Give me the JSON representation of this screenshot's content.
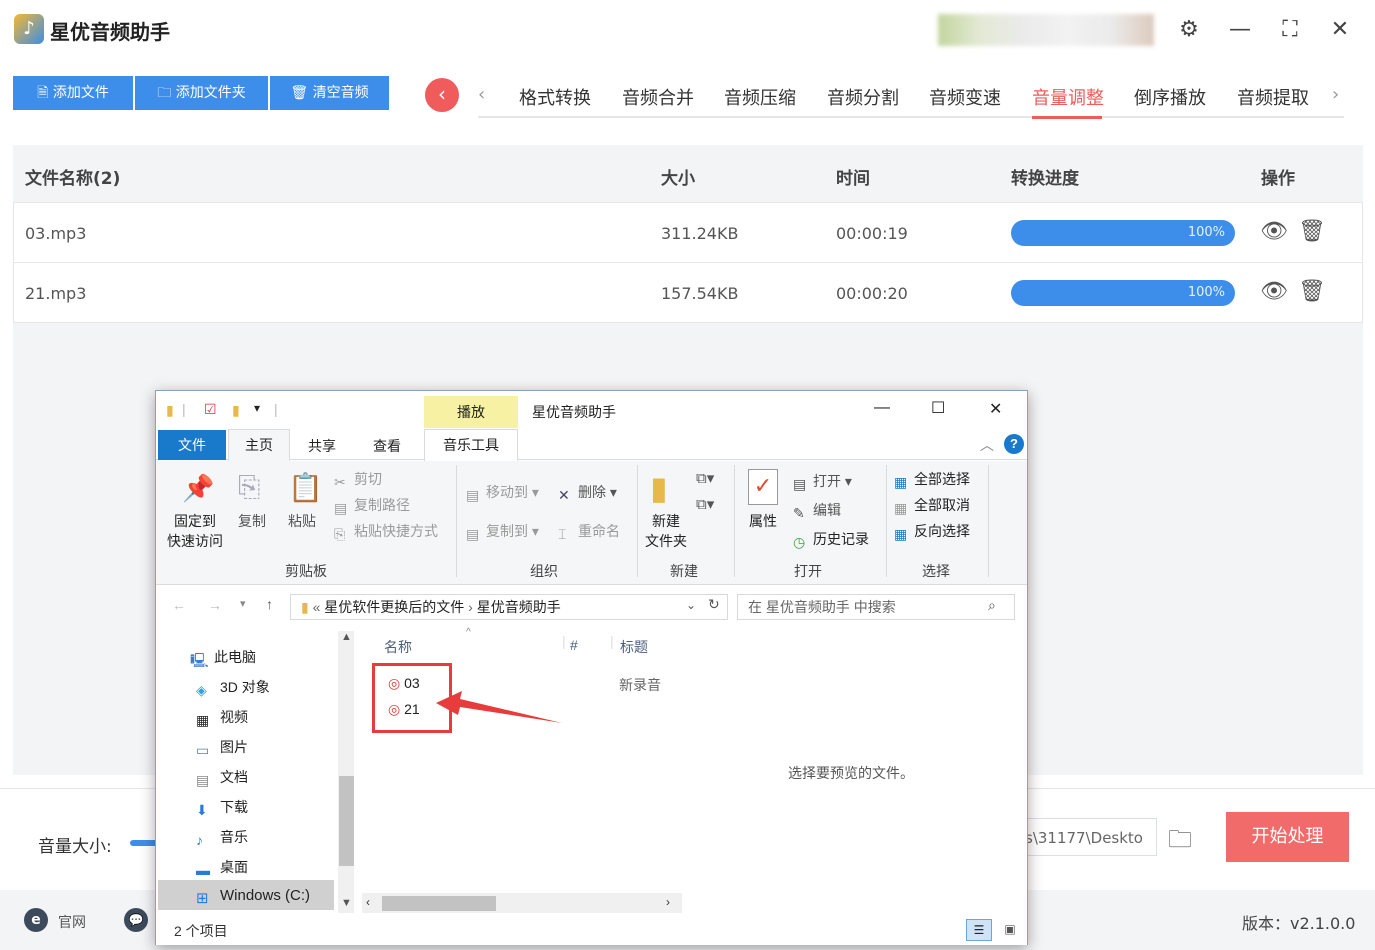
{
  "app": {
    "title": "星优音频助手",
    "window_controls": {
      "settings": "⚙",
      "minimize": "—",
      "maximize": "⛶",
      "close": "✕"
    }
  },
  "toolbar": {
    "add_file": "添加文件",
    "add_folder": "添加文件夹",
    "clear": "清空音频"
  },
  "tabs": {
    "prev": "‹",
    "next": "›",
    "items": [
      "格式转换",
      "音频合并",
      "音频压缩",
      "音频分割",
      "音频变速",
      "音量调整",
      "倒序播放",
      "音频提取"
    ],
    "active": "音量调整"
  },
  "table": {
    "headers": {
      "name": "文件名称(2)",
      "size": "大小",
      "time": "时间",
      "progress": "转换进度",
      "actions": "操作"
    },
    "rows": [
      {
        "name": "03.mp3",
        "size": "311.24KB",
        "time": "00:00:19",
        "progress": "100%",
        "progress_value": 100
      },
      {
        "name": "21.mp3",
        "size": "157.54KB",
        "time": "00:00:20",
        "progress": "100%",
        "progress_value": 100
      }
    ]
  },
  "bottom": {
    "volume_label": "音量大小:",
    "output_path": "s\\31177\\Deskto",
    "start_button": "开始处理"
  },
  "footer": {
    "site_label": "官网",
    "version": "版本：v2.1.0.0"
  },
  "explorer": {
    "context_tab": "播放",
    "title": "星优音频助手",
    "controls": {
      "minimize": "—",
      "maximize": "☐",
      "close": "✕"
    },
    "tabs": {
      "file": "文件",
      "home": "主页",
      "share": "共享",
      "view": "查看",
      "music_tools": "音乐工具"
    },
    "help": "?",
    "ribbon": {
      "clipboard": {
        "pin": [
          "固定到",
          "快速访问"
        ],
        "copy": "复制",
        "paste": "粘贴",
        "cut": "剪切",
        "copy_path": "复制路径",
        "paste_shortcut": "粘贴快捷方式",
        "label": "剪贴板"
      },
      "organize": {
        "move_to": "移动到",
        "copy_to": "复制到",
        "delete": "删除",
        "rename": "重命名",
        "label": "组织"
      },
      "new": {
        "new_folder": [
          "新建",
          "文件夹"
        ],
        "label": "新建"
      },
      "open": {
        "properties": "属性",
        "open": "打开",
        "edit": "编辑",
        "history": "历史记录",
        "label": "打开"
      },
      "select": {
        "select_all": "全部选择",
        "select_none": "全部取消",
        "invert": "反向选择",
        "label": "选择"
      }
    },
    "address": {
      "prefix": "«",
      "crumb1": "星优软件更换后的文件",
      "sep": "›",
      "crumb2": "星优音频助手"
    },
    "search_placeholder": "在 星优音频助手 中搜索",
    "nav": [
      "此电脑",
      "3D 对象",
      "视频",
      "图片",
      "文档",
      "下载",
      "音乐",
      "桌面",
      "Windows (C:)"
    ],
    "columns": {
      "name": "名称",
      "number": "#",
      "title": "标题"
    },
    "files": [
      {
        "name": "03",
        "title": "新录音"
      },
      {
        "name": "21",
        "title": ""
      }
    ],
    "preview_text": "选择要预览的文件。",
    "status": "2 个项目"
  },
  "colors": {
    "accent_blue": "#3d8eea",
    "accent_red": "#f05b5b",
    "start_button": "#f26b6b",
    "annotation": "#e83b3b"
  }
}
